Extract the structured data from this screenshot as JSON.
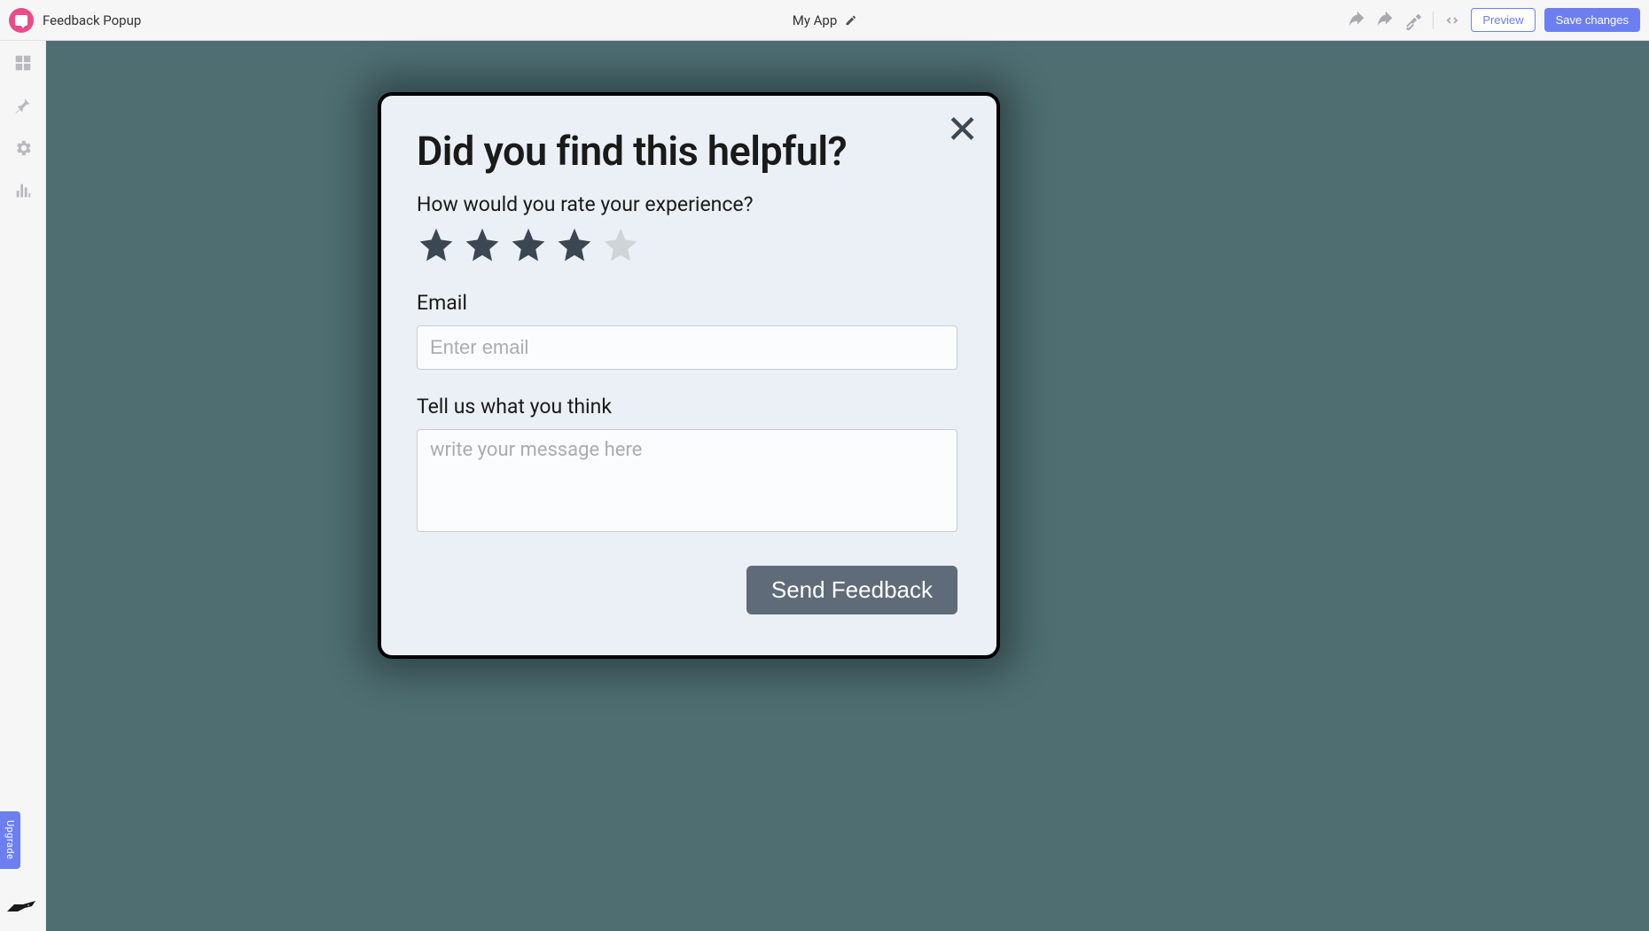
{
  "topbar": {
    "page_title": "Feedback Popup",
    "app_name": "My App",
    "preview_label": "Preview",
    "save_label": "Save changes"
  },
  "sidebar": {
    "upgrade_label": "Upgrade"
  },
  "popup": {
    "title": "Did you find this helpful?",
    "rate_question": "How would you rate your experience?",
    "rating_value": 4,
    "rating_max": 5,
    "email_label": "Email",
    "email_placeholder": "Enter email",
    "message_label": "Tell us what you think",
    "message_placeholder": "write your message here",
    "send_label": "Send Feedback"
  },
  "colors": {
    "canvas_bg": "#4e6e72",
    "popup_bg": "#eaf0f6",
    "accent": "#6d7ff0",
    "star_filled": "#3b4752",
    "star_empty": "#cfd4d8",
    "send_btn": "#5f6b78",
    "logo": "#ea4c89"
  }
}
